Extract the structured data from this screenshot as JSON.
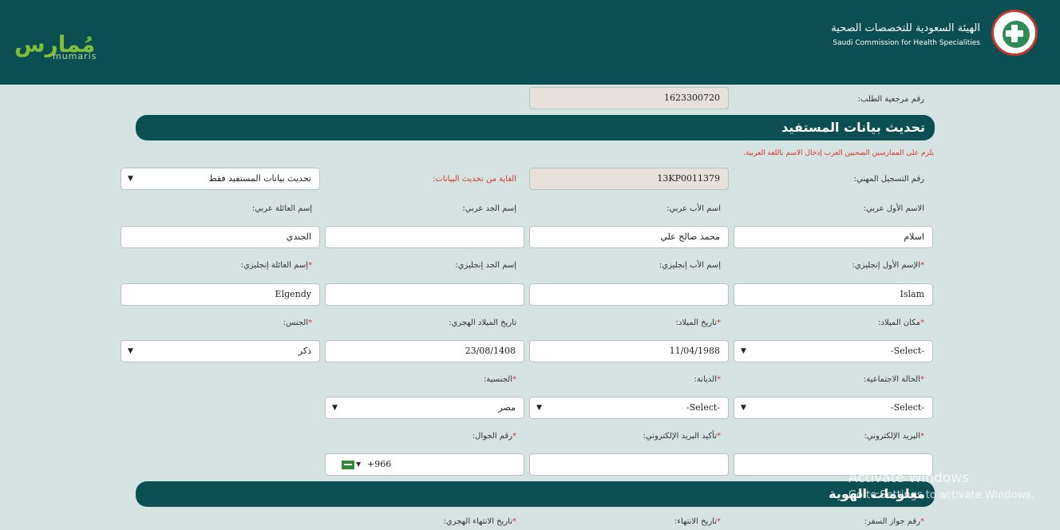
{
  "header": {
    "left_logo_ar": "مُمارس",
    "left_logo_lat": "mumaris",
    "org_name_ar": "الهيئة السعودية للتخصصات الصحية",
    "org_name_en": "Saudi Commission for Health Specialities"
  },
  "request_ref": {
    "label": "رقم مرجعية الطلب:",
    "value": "1623300720"
  },
  "section_update": {
    "title": "تحديث بيانات المستفيد"
  },
  "note": "يلزم على الممارسين الصحيين العرب إدخال الاسم باللغة العربية.",
  "registration": {
    "label": "رقم التسجيل المهني:",
    "value": "13KP0011379"
  },
  "purpose": {
    "label": "الغاية من تحديث البيانات:",
    "value": "تحديث بيانات المستفيد فقط"
  },
  "arabic_names": {
    "first_label": "الاسم الأول عربي:",
    "first_value": "اسلام",
    "father_label": "اسم الأب عربي:",
    "father_value": "محمد صالح علي",
    "grand_label": "إسم الجد عربي:",
    "grand_value": "",
    "family_label": "إسم العائلة عربي:",
    "family_value": "الجندي"
  },
  "english_names": {
    "first_label": "الإسم الأول إنجليزي:",
    "first_value": "Islam",
    "father_label": "إسم الأب إنجليزي:",
    "father_value": "",
    "grand_label": "إسم الجد إنجليزي:",
    "grand_value": "",
    "family_label": "إسم العائلة إنجليزي:",
    "family_value": "Elgendy"
  },
  "birth": {
    "place_label": "مكان الميلاد:",
    "place_value": "-Select-",
    "date_label": "تاريخ الميلاد:",
    "date_value": "11/04/1988",
    "hijri_label": "تاريخ الميلاد الهجري:",
    "hijri_value": "23/08/1408",
    "gender_label": "الجنس:",
    "gender_value": "ذكر"
  },
  "status": {
    "marital_label": "الحالة الاجتماعية:",
    "marital_value": "-Select-",
    "religion_label": "الديانة:",
    "religion_value": "-Select-",
    "nationality_label": "الجنسية:",
    "nationality_value": "مصر"
  },
  "contact": {
    "email_label": "البريد الإلكتروني:",
    "email_value": "",
    "email_confirm_label": "تأكيد البريد الإلكتروني:",
    "email_confirm_value": "",
    "mobile_label": "رقم الجوال:",
    "mobile_code": "+966"
  },
  "section_identity": {
    "title": "معلومات الهوية"
  },
  "identity": {
    "passport_label": "رقم جواز السفر:",
    "expiry_label": "تاريخ الانتهاء:",
    "expiry_hijri_label": "تاريخ الانتهاء الهجري:"
  },
  "watermark": {
    "line1": "Activate Windows",
    "line2": "Go to Settings to activate Windows."
  },
  "required_mark": "*",
  "caret": "▼"
}
